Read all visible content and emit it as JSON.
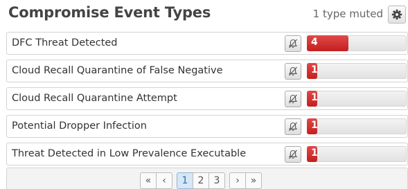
{
  "header": {
    "title": "Compromise Event Types",
    "muted_text": "1 type muted"
  },
  "rows": [
    {
      "label": "DFC Threat Detected",
      "count": "4",
      "fill_fraction": 0.42
    },
    {
      "label": "Cloud Recall Quarantine of False Negative",
      "count": "1",
      "fill_fraction": 0.105
    },
    {
      "label": "Cloud Recall Quarantine Attempt",
      "count": "1",
      "fill_fraction": 0.105
    },
    {
      "label": "Potential Dropper Infection",
      "count": "1",
      "fill_fraction": 0.105
    },
    {
      "label": "Threat Detected in Low Prevalence Executable",
      "count": "1",
      "fill_fraction": 0.105
    }
  ],
  "pagination": {
    "first_label": "«",
    "prev_label": "‹",
    "pages": [
      "1",
      "2",
      "3"
    ],
    "active_page": "1",
    "next_label": "›",
    "last_label": "»"
  },
  "colors": {
    "bar_fill": "#d13434",
    "active_page_bg": "#d6e7f5"
  },
  "icons": {
    "settings": "gear-icon",
    "mute": "bell-slash-icon"
  }
}
